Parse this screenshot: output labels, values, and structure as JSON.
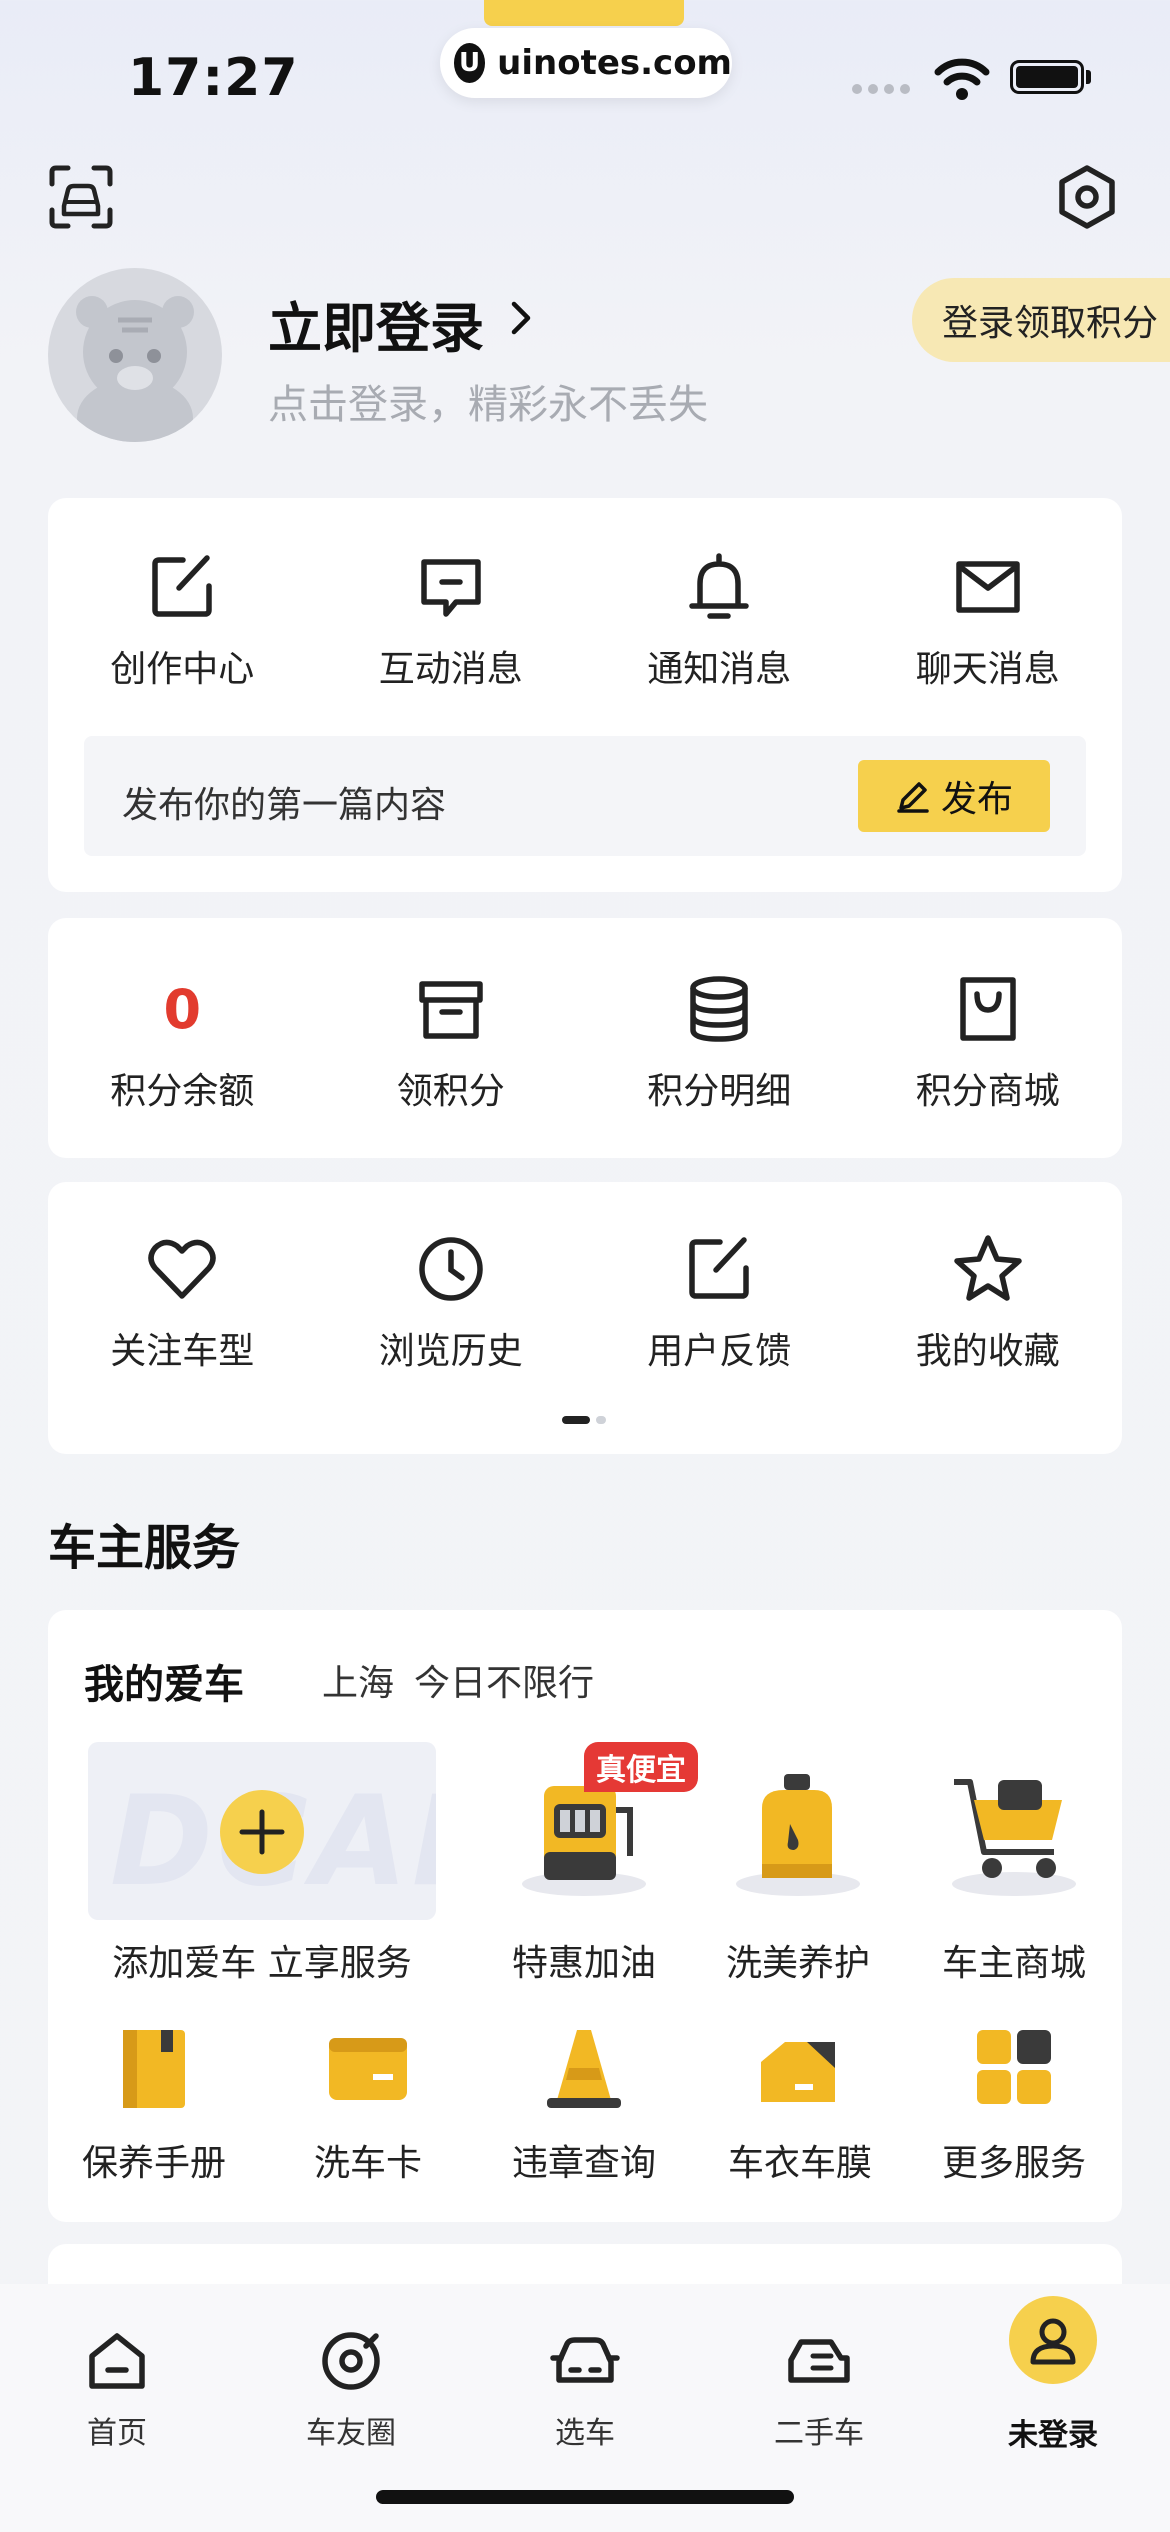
{
  "status_bar": {
    "time": "17:27",
    "url": "uinotes.com"
  },
  "profile": {
    "login_title": "立即登录",
    "login_subtitle": "点击登录，精彩永不丢失",
    "points_badge": "登录领取积分"
  },
  "messages": {
    "items": [
      {
        "label": "创作中心",
        "icon": "edit-icon"
      },
      {
        "label": "互动消息",
        "icon": "chat-icon"
      },
      {
        "label": "通知消息",
        "icon": "bell-icon"
      },
      {
        "label": "聊天消息",
        "icon": "mail-icon"
      }
    ],
    "publish_prompt": "发布你的第一篇内容",
    "publish_button": "发布"
  },
  "points": {
    "balance_value": "0",
    "items": [
      {
        "label": "积分余额"
      },
      {
        "label": "领积分",
        "icon": "box-icon"
      },
      {
        "label": "积分明细",
        "icon": "database-icon"
      },
      {
        "label": "积分商城",
        "icon": "shopping-bag-icon"
      }
    ]
  },
  "shortcuts": {
    "items": [
      {
        "label": "关注车型",
        "icon": "heart-icon"
      },
      {
        "label": "浏览历史",
        "icon": "clock-icon"
      },
      {
        "label": "用户反馈",
        "icon": "feedback-icon"
      },
      {
        "label": "我的收藏",
        "icon": "star-icon"
      }
    ],
    "page_indicator": {
      "pages": 2,
      "current": 1
    }
  },
  "owner_services": {
    "section_title": "车主服务",
    "card_title": "我的爱车",
    "city": "上海",
    "restriction": "今日不限行",
    "add_car_watermark": "DCAR",
    "add_car_label": "添加爱车 立享服务",
    "hot_tag": "真便宜",
    "row1": [
      {
        "label": "特惠加油",
        "icon": "fuel-pump-icon"
      },
      {
        "label": "洗美养护",
        "icon": "oil-bottle-icon"
      },
      {
        "label": "车主商城",
        "icon": "shopping-cart-icon"
      }
    ],
    "row2": [
      {
        "label": "保养手册",
        "icon": "manual-book-icon"
      },
      {
        "label": "洗车卡",
        "icon": "card-icon"
      },
      {
        "label": "违章查询",
        "icon": "traffic-cone-icon"
      },
      {
        "label": "车衣车膜",
        "icon": "car-film-icon"
      },
      {
        "label": "更多服务",
        "icon": "more-grid-icon"
      }
    ]
  },
  "tabbar": {
    "items": [
      {
        "label": "首页",
        "icon": "home-icon"
      },
      {
        "label": "车友圈",
        "icon": "community-icon"
      },
      {
        "label": "选车",
        "icon": "car-icon"
      },
      {
        "label": "二手车",
        "icon": "used-car-icon"
      },
      {
        "label": "未登录",
        "icon": "user-icon",
        "active": true
      }
    ]
  },
  "colors": {
    "accent": "#f6d04d",
    "danger": "#e23b2e",
    "badge_bg": "#f7e8b4"
  }
}
